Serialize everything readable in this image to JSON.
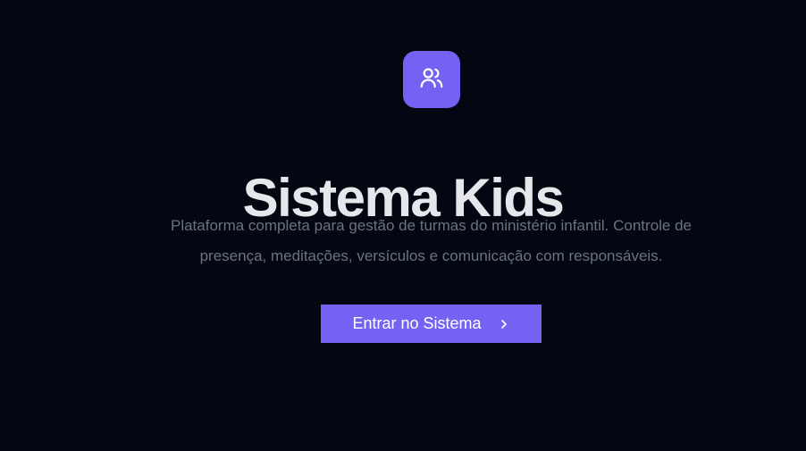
{
  "hero": {
    "logo_icon": "users-icon",
    "title": "Sistema Kids",
    "description_line1": "Plataforma completa para gestão de turmas do ministério infantil. Controle de",
    "description_line2": "presença, meditações, versículos e comunicação com responsáveis.",
    "cta_label": "Entrar no Sistema",
    "cta_icon": "chevron-right-icon"
  },
  "colors": {
    "background": "#030712",
    "accent": "#7463f2",
    "title": "#e5e7eb",
    "description": "#6b7280"
  }
}
